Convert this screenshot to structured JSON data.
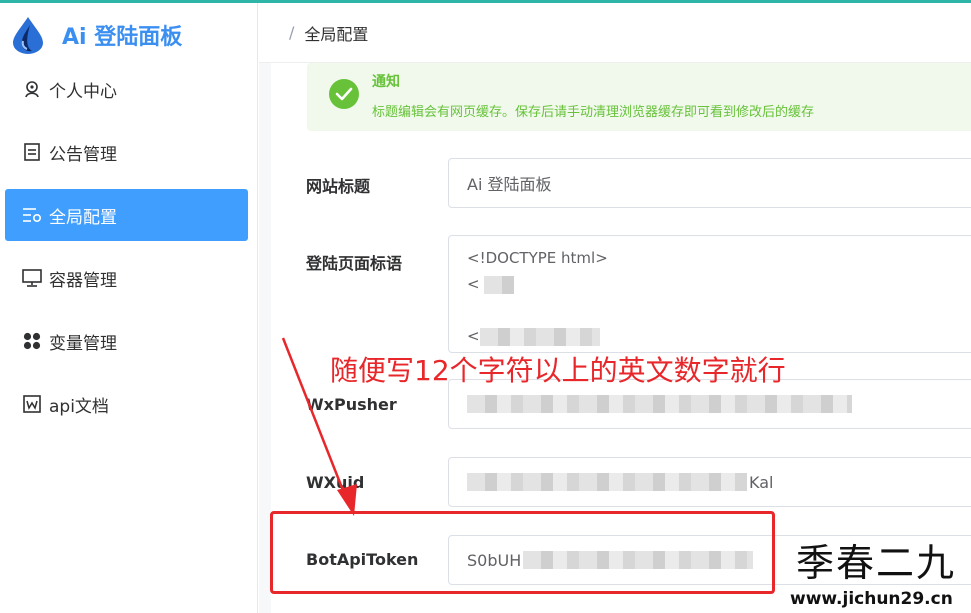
{
  "app": {
    "title": "Ai 登陆面板",
    "accent": "#409eff",
    "brand_color": "#3b8ff0"
  },
  "sidebar": {
    "items": [
      {
        "label": "个人中心",
        "icon": "user-circle-icon",
        "active": false
      },
      {
        "label": "公告管理",
        "icon": "document-icon",
        "active": false
      },
      {
        "label": "全局配置",
        "icon": "settings-list-icon",
        "active": true
      },
      {
        "label": "容器管理",
        "icon": "monitor-icon",
        "active": false
      },
      {
        "label": "变量管理",
        "icon": "grid-dots-icon",
        "active": false
      },
      {
        "label": "api文档",
        "icon": "word-doc-icon",
        "active": false
      }
    ]
  },
  "header": {
    "separator": "/",
    "breadcrumb": "全局配置"
  },
  "notice": {
    "title": "通知",
    "description": "标题编辑会有网页缓存。保存后请手动清理浏览器缓存即可看到修改后的缓存",
    "color": "#67c23a"
  },
  "form": {
    "site_title_label": "网站标题",
    "site_title_value": "Ai 登陆面板",
    "login_slogan_label": "登陆页面标语",
    "login_slogan_line1": "<!DOCTYPE html>",
    "login_slogan_line2": "<",
    "login_slogan_line3": "<",
    "wxpusher_label": "WxPusher",
    "wxuid_label": "WXuid",
    "wxuid_tail": "Kal",
    "bot_token_label": "BotApiToken",
    "bot_token_prefix": "S0bUH"
  },
  "annotation": {
    "text": "随便写12个字符以上的英文数字就行",
    "color": "#e8272b"
  },
  "watermark": {
    "cn": "季春二九",
    "url": "www.jichun29.cn"
  }
}
